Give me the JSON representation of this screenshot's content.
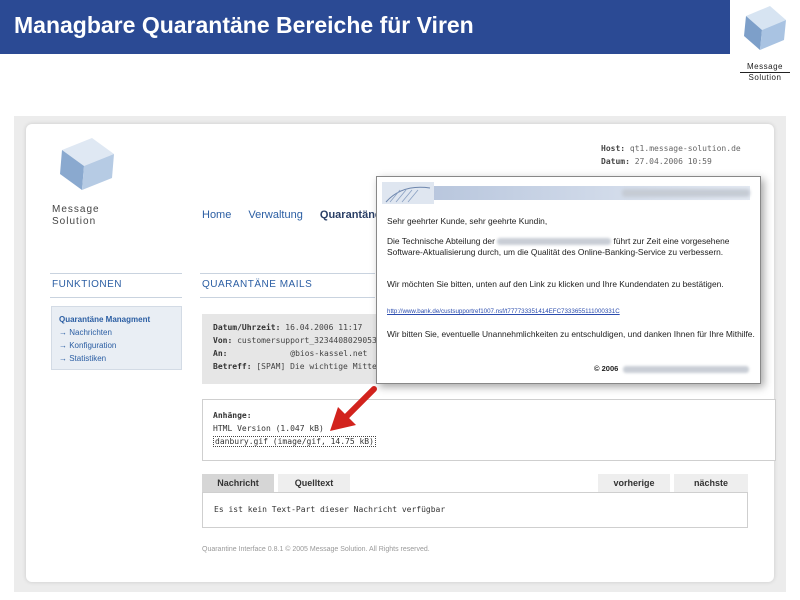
{
  "slide": {
    "title": "Managbare Quarantäne Bereiche für Viren"
  },
  "corner_logo": {
    "line1": "Message",
    "line2": "Solution"
  },
  "app": {
    "brand_line1": "Message",
    "brand_line2": "Solution",
    "meta": {
      "host_label": "Host:",
      "host": "qt1.message-solution.de",
      "datum_label": "Datum:",
      "datum": "27.04.2006 10:59"
    },
    "nav": [
      "Home",
      "Verwaltung",
      "Quarantäne"
    ],
    "sidebar": {
      "title": "FUNKTIONEN",
      "items": [
        "Quarantäne Managment",
        "→ Nachrichten",
        "→ Konfiguration",
        "→ Statistiken"
      ]
    },
    "main": {
      "title": "QUARANTÄNE MAILS",
      "header": {
        "date_label": "Datum/Uhrzeit:",
        "date": "16.04.2006 11:17",
        "from_label": "Von:",
        "from": "customersupport_3234408029053",
        "to_label": "An:",
        "to": "@bios-kassel.net",
        "subject_label": "Betreff:",
        "subject": "[SPAM] Die wichtige Mitteilung"
      },
      "attachments": {
        "title": "Anhänge:",
        "items": [
          "HTML Version (1.047 kB)",
          "danbury.gif (image/gif, 14.75 kB)"
        ]
      },
      "tabs": [
        "Nachricht",
        "Quelltext",
        "vorherige",
        "nächste"
      ],
      "content_text": "Es ist kein Text-Part dieser Nachricht verfügbar",
      "footer": "Quarantine Interface 0.8.1 © 2005 Message Solution. All Rights reserved."
    }
  },
  "overlay": {
    "greeting": "Sehr geehrter Kunde, sehr geehrte Kundin,",
    "para1_a": "Die Technische Abteilung der",
    "para1_b": "führt zur Zeit eine vorgesehene Software-Aktualisierung durch, um die Qualität des Online-Banking-Service zu verbessern.",
    "para2": "Wir möchten Sie bitten, unten auf den Link zu klicken und Ihre Kundendaten zu bestätigen.",
    "link": "http://www.bank.de/custsupportref1007.nsf/t777733351414EFC7333655111000331C",
    "para3": "Wir bitten Sie, eventuelle Unannehmlichkeiten zu entschuldigen, und danken Ihnen für Ihre Mithilfe.",
    "copyright": "© 2006"
  },
  "colors": {
    "header_blue": "#2b4a94",
    "link_blue": "#2b5ea3",
    "arrow_red": "#d2231d"
  }
}
